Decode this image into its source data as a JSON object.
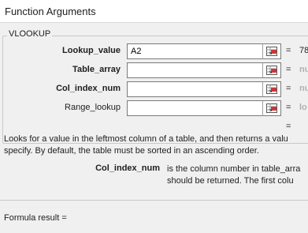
{
  "window": {
    "title": "Function Arguments"
  },
  "function_group": {
    "name": "VLOOKUP"
  },
  "arguments": [
    {
      "label": "Lookup_value",
      "bold": true,
      "value": "A2",
      "result": "78",
      "result_gray": false,
      "ref_icon": "collapse-dialog-icon"
    },
    {
      "label": "Table_array",
      "bold": true,
      "value": "",
      "result": "nu",
      "result_gray": true,
      "ref_icon": "collapse-dialog-icon"
    },
    {
      "label": "Col_index_num",
      "bold": true,
      "value": "",
      "result": "nu",
      "result_gray": true,
      "ref_icon": "collapse-dialog-icon"
    },
    {
      "label": "Range_lookup",
      "bold": false,
      "value": "",
      "result": "lo",
      "result_gray": true,
      "ref_icon": "collapse-dialog-icon"
    }
  ],
  "equals_sign": "=",
  "description": {
    "line1": "Looks for a value in the leftmost column of a table, and then returns a valu",
    "line2": "specify. By default, the table must be sorted in an ascending order."
  },
  "argument_help": {
    "name": "Col_index_num",
    "line1": "is the column number in table_arra",
    "line2": "should be returned. The first colu"
  },
  "footer": {
    "formula_result": "Formula result ="
  },
  "colors": {
    "background": "#f0f0f0",
    "input_border": "#7a7a7a",
    "gray_result": "#b0b0b0"
  }
}
